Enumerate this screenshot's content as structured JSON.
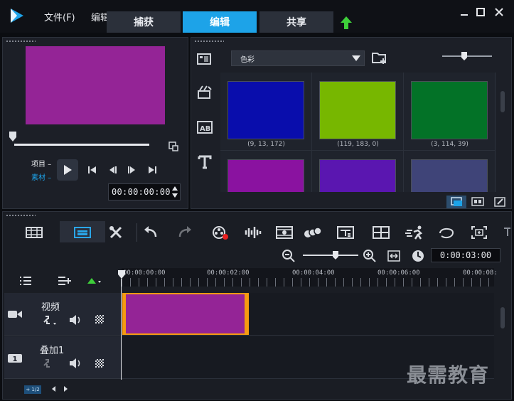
{
  "menu": {
    "file": "文件(F)",
    "edit": "编辑"
  },
  "tabs": [
    {
      "label": "捕获",
      "active": false
    },
    {
      "label": "编辑",
      "active": true
    },
    {
      "label": "共享",
      "active": false
    }
  ],
  "preview": {
    "color": "#942496",
    "mode_project": "项目",
    "mode_clip": "素材",
    "timecode": "00:00:00:00"
  },
  "library": {
    "category": "色彩",
    "swatches": [
      {
        "label": "(9, 13, 172)",
        "color": "#090dac"
      },
      {
        "label": "(119, 183, 0)",
        "color": "#77b700"
      },
      {
        "label": "(3, 114, 39)",
        "color": "#037227"
      },
      {
        "label": "",
        "color": "#8a12a0"
      },
      {
        "label": "",
        "color": "#5a16b0"
      },
      {
        "label": "",
        "color": "#3f4478"
      }
    ]
  },
  "timeline": {
    "duration": "0:00:03:00",
    "ruler": [
      "00:00:00:00",
      "00:00:02:00",
      "00:00:04:00",
      "00:00:06:00",
      "00:00:08:"
    ],
    "tracks": [
      {
        "name": "视频",
        "badge": "video-track-icon"
      },
      {
        "name": "叠加1",
        "badge": "1"
      }
    ],
    "clip_color": "#942496",
    "clip_border": "#f59a12"
  },
  "footer": {
    "tag": "+ 1/2"
  },
  "watermark": "最需教育",
  "colors": {
    "accent": "#1da3e8",
    "upload_arrow": "#3ecf3a"
  }
}
